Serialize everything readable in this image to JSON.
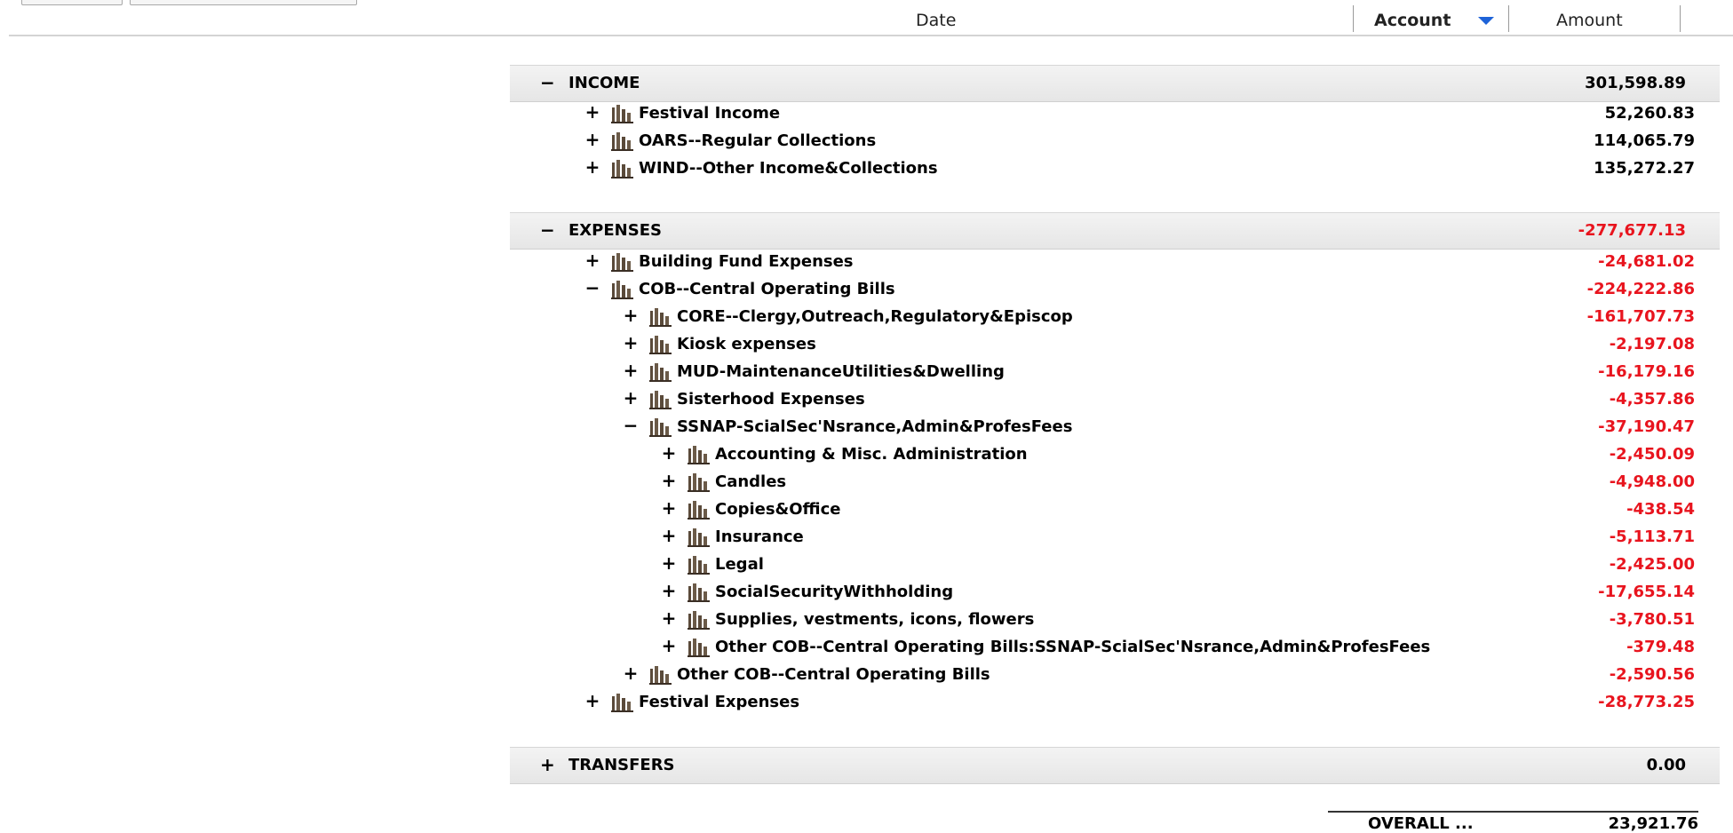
{
  "columns": {
    "date": "Date",
    "account": "Account",
    "amount": "Amount"
  },
  "colors": {
    "negative": "#e8141e",
    "sort_arrow": "#1e63d8"
  },
  "icon": "bar-chart-icon",
  "sections": {
    "income": {
      "toggle": "−",
      "label": "INCOME",
      "amount": "301,598.89"
    },
    "expenses": {
      "toggle": "−",
      "label": "EXPENSES",
      "amount": "-277,677.13"
    },
    "transfers": {
      "toggle": "+",
      "label": "TRANSFERS",
      "amount": "0.00"
    }
  },
  "income_rows": [
    {
      "toggle": "+",
      "label": "Festival Income",
      "amount": "52,260.83"
    },
    {
      "toggle": "+",
      "label": "OARS--Regular Collections",
      "amount": "114,065.79"
    },
    {
      "toggle": "+",
      "label": "WIND--Other Income&Collections",
      "amount": "135,272.27"
    }
  ],
  "expense_rows": [
    {
      "toggle": "+",
      "label": "Building Fund Expenses",
      "amount": "-24,681.02"
    },
    {
      "toggle": "−",
      "label": "COB--Central Operating Bills",
      "amount": "-224,222.86"
    },
    {
      "toggle": "+",
      "label": "CORE--Clergy,Outreach,Regulatory&Episcop",
      "amount": "-161,707.73"
    },
    {
      "toggle": "+",
      "label": "Kiosk expenses",
      "amount": "-2,197.08"
    },
    {
      "toggle": "+",
      "label": "MUD-MaintenanceUtilities&Dwelling",
      "amount": "-16,179.16"
    },
    {
      "toggle": "+",
      "label": "Sisterhood Expenses",
      "amount": "-4,357.86"
    },
    {
      "toggle": "−",
      "label": "SSNAP-ScialSec'Nsrance,Admin&ProfesFees",
      "amount": "-37,190.47"
    },
    {
      "toggle": "+",
      "label": "Accounting & Misc. Administration",
      "amount": "-2,450.09"
    },
    {
      "toggle": "+",
      "label": "Candles",
      "amount": "-4,948.00"
    },
    {
      "toggle": "+",
      "label": "Copies&Office",
      "amount": "-438.54"
    },
    {
      "toggle": "+",
      "label": "Insurance",
      "amount": "-5,113.71"
    },
    {
      "toggle": "+",
      "label": "Legal",
      "amount": "-2,425.00"
    },
    {
      "toggle": "+",
      "label": "SocialSecurityWithholding",
      "amount": "-17,655.14"
    },
    {
      "toggle": "+",
      "label": "Supplies, vestments, icons, flowers",
      "amount": "-3,780.51"
    },
    {
      "toggle": "+",
      "label": "Other COB--Central Operating Bills:SSNAP-ScialSec'Nsrance,Admin&ProfesFees",
      "amount": "-379.48"
    },
    {
      "toggle": "+",
      "label": "Other COB--Central Operating Bills",
      "amount": "-2,590.56"
    },
    {
      "toggle": "+",
      "label": "Festival Expenses",
      "amount": "-28,773.25"
    }
  ],
  "overall": {
    "label": "OVERALL ...",
    "amount": "23,921.76"
  }
}
